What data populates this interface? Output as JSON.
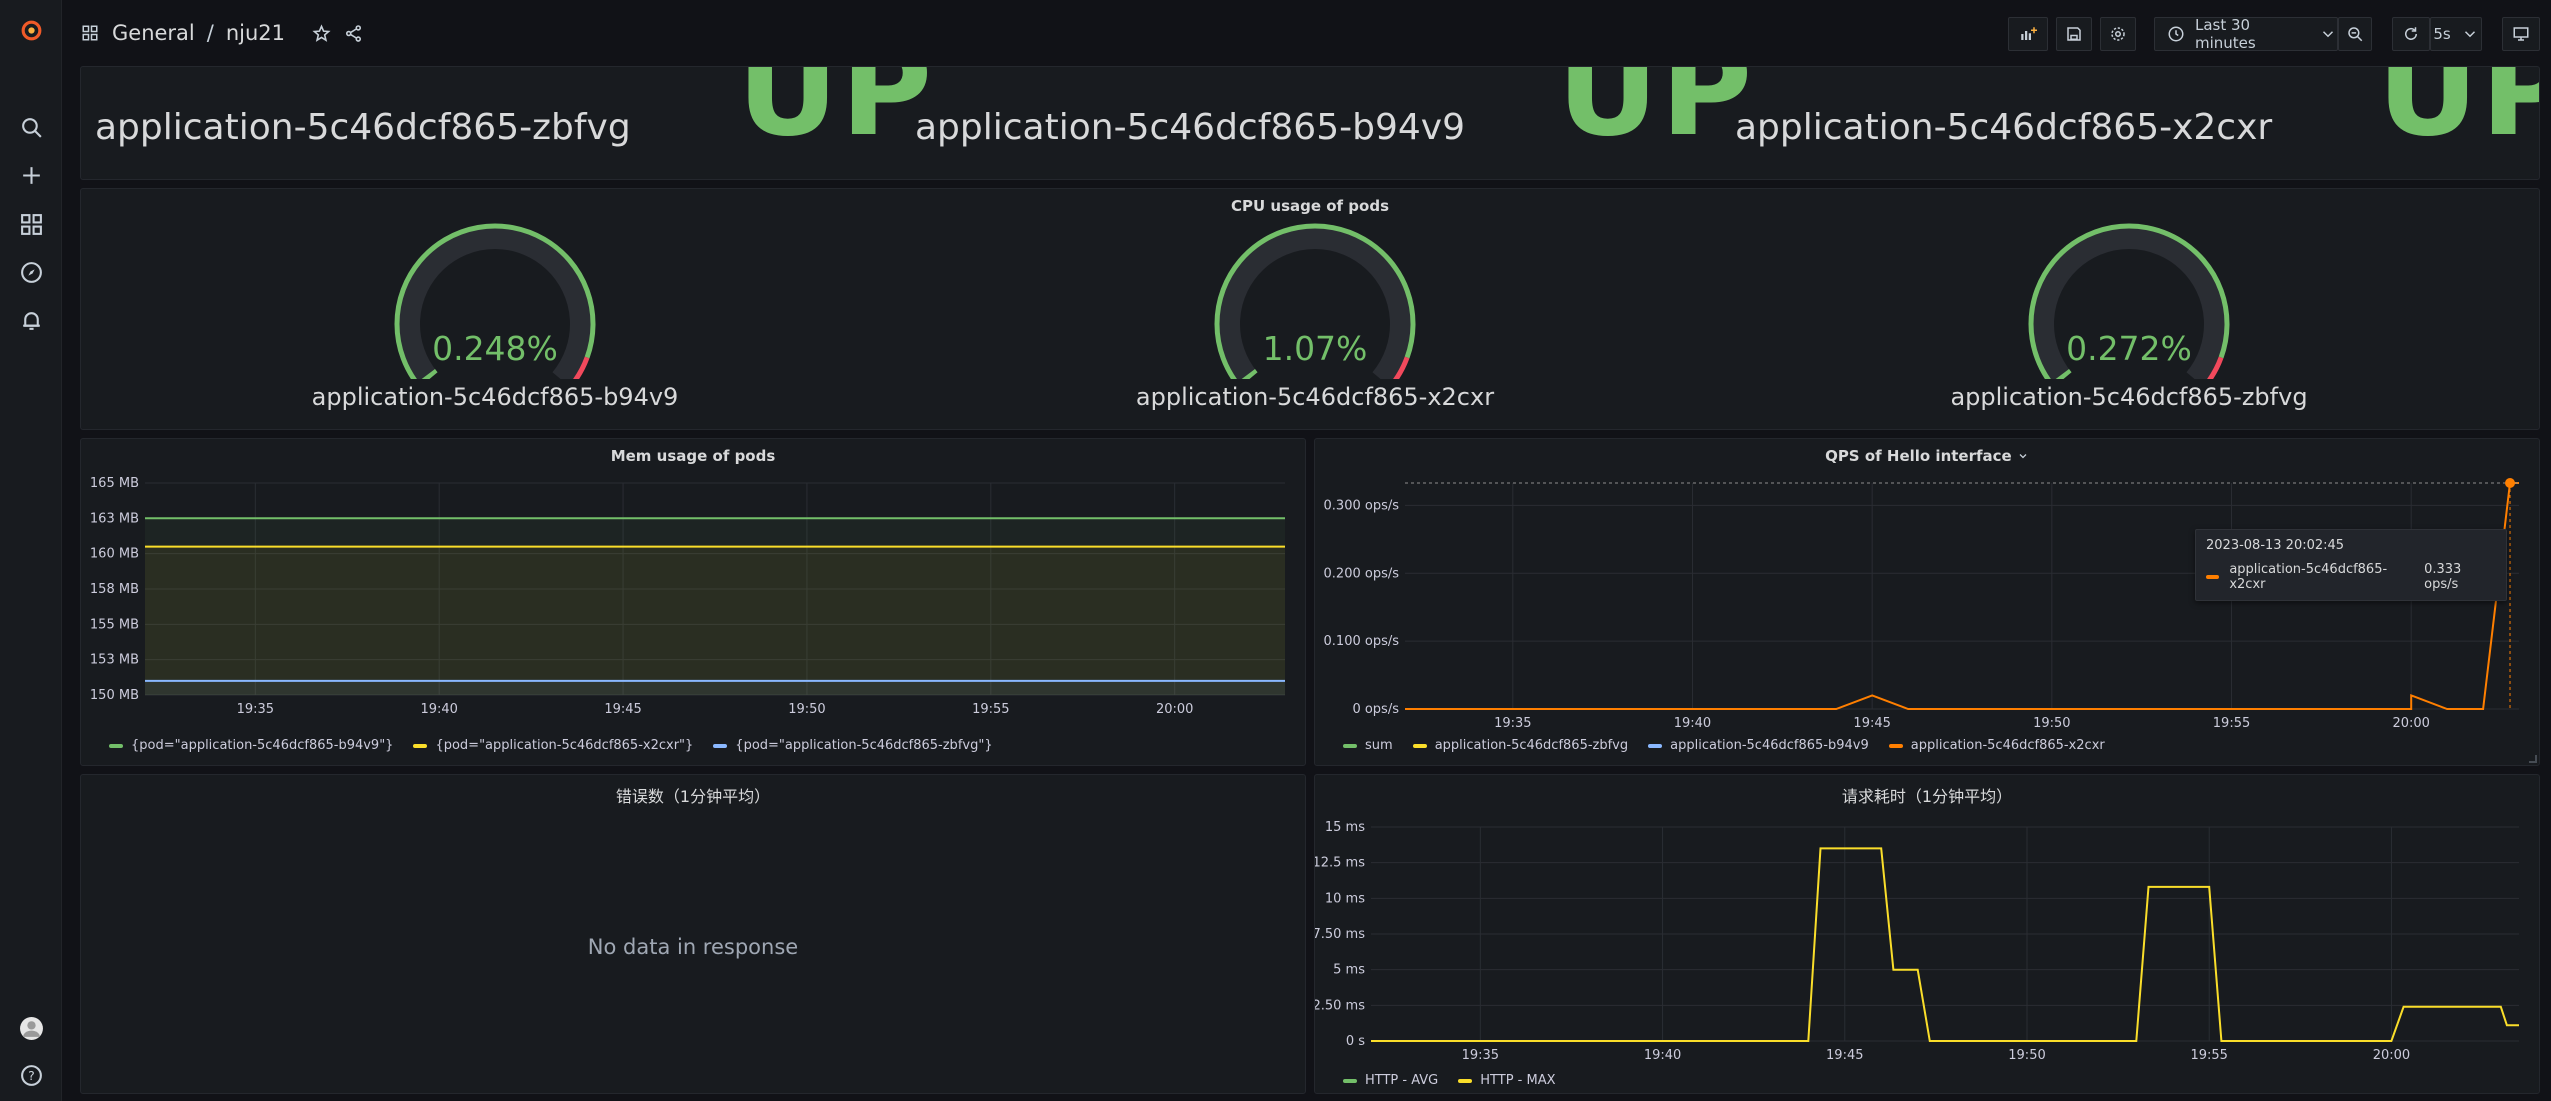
{
  "breadcrumb": {
    "folder": "General",
    "separator": "/",
    "dashboard": "nju21"
  },
  "toolbar": {
    "time_range": "Last 30 minutes",
    "refresh_interval": "5s"
  },
  "stats": [
    {
      "name": "application-5c46dcf865-zbfvg",
      "value": "UP"
    },
    {
      "name": "application-5c46dcf865-b94v9",
      "value": "UP"
    },
    {
      "name": "application-5c46dcf865-x2cxr",
      "value": "UP"
    }
  ],
  "cpu_panel": {
    "title": "CPU usage of pods",
    "gauges": [
      {
        "label": "application-5c46dcf865-b94v9",
        "value_text": "0.248%",
        "value": 0.248
      },
      {
        "label": "application-5c46dcf865-x2cxr",
        "value_text": "1.07%",
        "value": 1.07
      },
      {
        "label": "application-5c46dcf865-zbfvg",
        "value_text": "0.272%",
        "value": 0.272
      }
    ]
  },
  "mem_panel": {
    "title": "Mem usage of pods",
    "legend": [
      {
        "label": "{pod=\"application-5c46dcf865-b94v9\"}",
        "color": "#73bf69"
      },
      {
        "label": "{pod=\"application-5c46dcf865-x2cxr\"}",
        "color": "#fade2a"
      },
      {
        "label": "{pod=\"application-5c46dcf865-zbfvg\"}",
        "color": "#8ab8ff"
      }
    ]
  },
  "qps_panel": {
    "title": "QPS of Hello interface",
    "legend": [
      {
        "label": "sum",
        "color": "#73bf69"
      },
      {
        "label": "application-5c46dcf865-zbfvg",
        "color": "#fade2a"
      },
      {
        "label": "application-5c46dcf865-b94v9",
        "color": "#8ab8ff"
      },
      {
        "label": "application-5c46dcf865-x2cxr",
        "color": "#ff7f00"
      }
    ],
    "tooltip": {
      "time": "2023-08-13 20:02:45",
      "series": "application-5c46dcf865-x2cxr",
      "value": "0.333 ops/s"
    }
  },
  "error_panel": {
    "title": "错误数（1分钟平均）",
    "message": "No data in response"
  },
  "latency_panel": {
    "title": "请求耗时（1分钟平均）",
    "legend": [
      {
        "label": "HTTP - AVG",
        "color": "#73bf69"
      },
      {
        "label": "HTTP - MAX",
        "color": "#fade2a"
      }
    ]
  },
  "chart_data": [
    {
      "type": "gauge",
      "title": "CPU usage of pods",
      "categories": [
        "application-5c46dcf865-b94v9",
        "application-5c46dcf865-x2cxr",
        "application-5c46dcf865-zbfvg"
      ],
      "values": [
        0.248,
        1.07,
        0.272
      ],
      "unit": "%"
    },
    {
      "type": "line",
      "title": "Mem usage of pods",
      "x_ticks": [
        "19:35",
        "19:40",
        "19:45",
        "19:50",
        "19:55",
        "20:00"
      ],
      "y_ticks": [
        "150 MB",
        "153 MB",
        "155 MB",
        "158 MB",
        "160 MB",
        "163 MB",
        "165 MB"
      ],
      "ylim": [
        150,
        165
      ],
      "x": [
        "19:32",
        "19:40",
        "19:45",
        "19:50",
        "19:55",
        "20:00",
        "20:03"
      ],
      "series": [
        {
          "name": "{pod=\"application-5c46dcf865-b94v9\"}",
          "values": [
            162.5,
            162.5,
            162.5,
            162.5,
            162.5,
            162.5,
            162.5
          ]
        },
        {
          "name": "{pod=\"application-5c46dcf865-x2cxr\"}",
          "values": [
            160.5,
            160.5,
            160.5,
            160.5,
            160.5,
            160.5,
            160.5
          ]
        },
        {
          "name": "{pod=\"application-5c46dcf865-zbfvg\"}",
          "values": [
            151.0,
            151.0,
            151.0,
            151.0,
            151.0,
            151.0,
            151.0
          ]
        }
      ],
      "grid": true,
      "legend_position": "bottom"
    },
    {
      "type": "line",
      "title": "QPS of Hello interface",
      "x_ticks": [
        "19:35",
        "19:40",
        "19:45",
        "19:50",
        "19:55",
        "20:00"
      ],
      "y_ticks": [
        "0 ops/s",
        "0.100 ops/s",
        "0.200 ops/s",
        "0.300 ops/s"
      ],
      "ylim": [
        0,
        0.333
      ],
      "x": [
        "19:32",
        "19:44",
        "19:45",
        "19:46",
        "20:00",
        "20:00",
        "20:01",
        "20:02",
        "20:02:45",
        "20:03"
      ],
      "series": [
        {
          "name": "application-5c46dcf865-x2cxr",
          "values": [
            0,
            0,
            0.02,
            0,
            0,
            0.02,
            0,
            0,
            0.333,
            0.333
          ]
        }
      ],
      "grid": true,
      "legend_position": "bottom"
    },
    {
      "type": "line",
      "title": "请求耗时（1分钟平均）",
      "x_ticks": [
        "19:35",
        "19:40",
        "19:45",
        "19:50",
        "19:55",
        "20:00"
      ],
      "y_ticks": [
        "0 s",
        "2.50 ms",
        "5 ms",
        "7.50 ms",
        "10 ms",
        "12.5 ms",
        "15 ms"
      ],
      "ylim": [
        0,
        15
      ],
      "x": [
        "19:32",
        "19:44",
        "19:44:20",
        "19:46",
        "19:46:20",
        "19:47",
        "19:47:20",
        "19:53",
        "19:53:20",
        "19:55",
        "19:55:20",
        "20:00",
        "20:00:20",
        "20:03",
        "20:03:10",
        "20:03:30"
      ],
      "series": [
        {
          "name": "HTTP - MAX",
          "values": [
            0,
            0,
            13.5,
            13.5,
            5,
            5,
            0,
            0,
            10.8,
            10.8,
            0,
            0,
            2.4,
            2.4,
            1.1,
            1.1
          ]
        }
      ],
      "grid": true,
      "legend_position": "bottom"
    }
  ]
}
